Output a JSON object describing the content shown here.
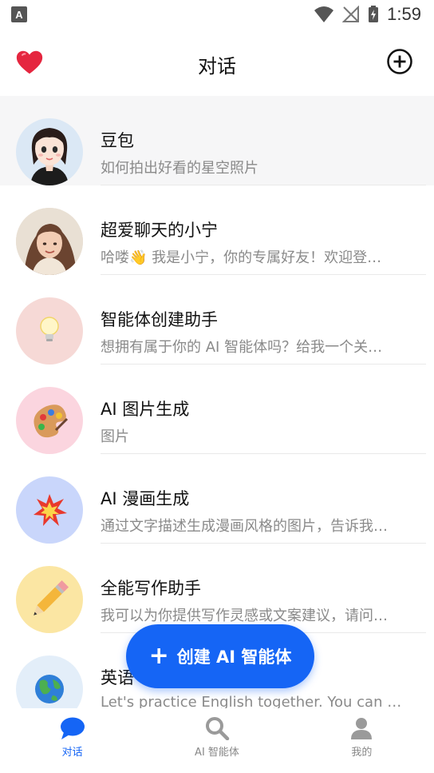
{
  "status_bar": {
    "time": "1:59",
    "left_badge": "A"
  },
  "header": {
    "title": "对话"
  },
  "conversations": [
    {
      "name": "豆包",
      "message": "如何拍出好看的星空照片",
      "avatar": "doubao-avatar",
      "bg": "#dbe8f5",
      "selected": true
    },
    {
      "name": "超爱聊天的小宁",
      "message": "哈喽👋 我是小宁，你的专属好友！欢迎登…",
      "avatar": "xiaoning-avatar",
      "bg": "#e7dccd",
      "selected": false
    },
    {
      "name": "智能体创建助手",
      "message": "想拥有属于你的 AI 智能体吗？给我一个关…",
      "avatar": "lightbulb-icon",
      "bg": "#f6d9d6",
      "selected": false
    },
    {
      "name": "AI 图片生成",
      "message": "图片",
      "avatar": "palette-icon",
      "bg": "#fbd5df",
      "selected": false
    },
    {
      "name": "AI 漫画生成",
      "message": "通过文字描述生成漫画风格的图片，告诉我…",
      "avatar": "explosion-icon",
      "bg": "#c9d6fb",
      "selected": false
    },
    {
      "name": "全能写作助手",
      "message": "我可以为你提供写作灵感或文案建议，请问…",
      "avatar": "pencil-icon",
      "bg": "#fbe6a3",
      "selected": false
    },
    {
      "name": "英语",
      "message": "Let's practice English together. You can try t…",
      "avatar": "globe-icon",
      "bg": "#e3eef9",
      "selected": false
    }
  ],
  "fab": {
    "label": "创建 AI 智能体",
    "plus": "+"
  },
  "tabs": [
    {
      "label": "对话",
      "icon": "chat-bubble-icon",
      "active": true
    },
    {
      "label": "AI 智能体",
      "icon": "search-icon",
      "active": false
    },
    {
      "label": "我的",
      "icon": "person-icon",
      "active": false
    }
  ],
  "colors": {
    "accent": "#1565f5",
    "subtext": "#8a8a8a",
    "inactive_tab": "#9a9a9a"
  }
}
